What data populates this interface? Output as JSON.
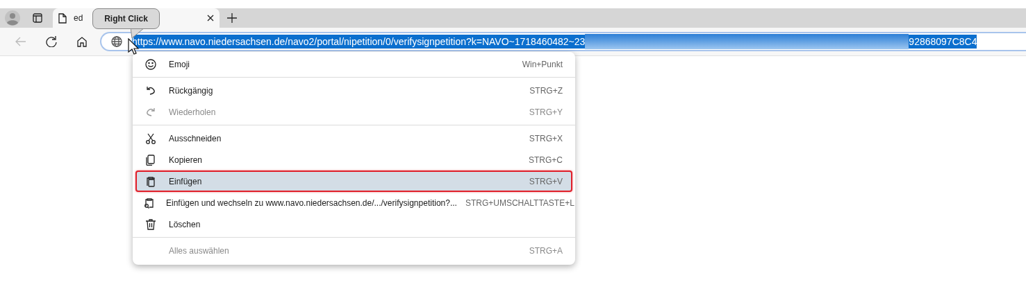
{
  "tabs": [
    {
      "title": "ed",
      "selected": true
    }
  ],
  "tooltip": {
    "text": "Right Click"
  },
  "address_bar": {
    "url_start": "https://www.navo.niedersachsen.de/navo2/portal/nipetition/0/verifysignpetition?k=NAVO~1718460482~23",
    "url_end": "92868097C8C4",
    "selected": true
  },
  "context_menu": [
    {
      "kind": "item",
      "label": "Emoji",
      "shortcut": "Win+Punkt",
      "disabled": false,
      "selected": false,
      "outlined": false
    },
    {
      "kind": "separator"
    },
    {
      "kind": "item",
      "label": "Rückgängig",
      "shortcut": "STRG+Z",
      "disabled": false,
      "selected": false,
      "outlined": false
    },
    {
      "kind": "item",
      "label": "Wiederholen",
      "shortcut": "STRG+Y",
      "disabled": true,
      "selected": false,
      "outlined": false
    },
    {
      "kind": "separator"
    },
    {
      "kind": "item",
      "label": "Ausschneiden",
      "shortcut": "STRG+X",
      "disabled": false,
      "selected": false,
      "outlined": false
    },
    {
      "kind": "item",
      "label": "Kopieren",
      "shortcut": "STRG+C",
      "disabled": false,
      "selected": false,
      "outlined": false
    },
    {
      "kind": "item",
      "label": "Einfügen",
      "shortcut": "STRG+V",
      "disabled": false,
      "selected": true,
      "outlined": true
    },
    {
      "kind": "item",
      "label": "Einfügen und wechseln zu www.navo.niedersachsen.de/.../verifysignpetition?...",
      "shortcut": "STRG+UMSCHALTTASTE+L",
      "disabled": false,
      "selected": false,
      "outlined": false
    },
    {
      "kind": "item",
      "label": "Löschen",
      "disabled": false,
      "selected": false,
      "outlined": false
    },
    {
      "kind": "separator"
    },
    {
      "kind": "item",
      "label": "Alles auswählen",
      "shortcut": "STRG+A",
      "disabled": true,
      "selected": false,
      "outlined": false
    }
  ]
}
